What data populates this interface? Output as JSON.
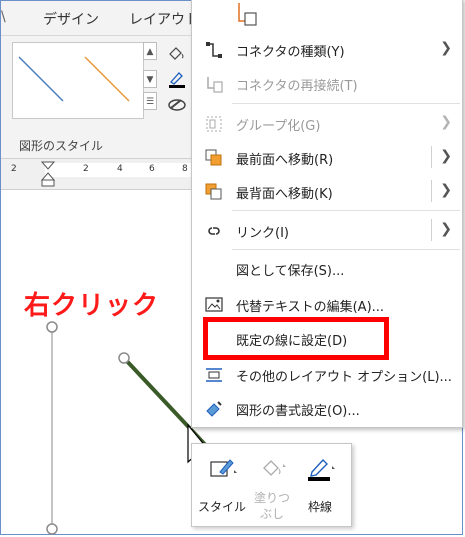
{
  "ribbon": {
    "tabs": [
      {
        "label": "デザイン"
      },
      {
        "label": "レイアウト"
      }
    ],
    "group_label": "図形のスタイル",
    "ruler_numbers": [
      "2",
      "2",
      "4",
      "6",
      "8"
    ]
  },
  "annotation": {
    "text": "右クリック",
    "color": "#ff1a1a"
  },
  "context_menu": {
    "items": [
      {
        "label": "コネクタの種類(Y)",
        "icon": "connector-type-icon",
        "submenu": true,
        "disabled": false
      },
      {
        "label": "コネクタの再接続(T)",
        "icon": "reroute-connector-icon",
        "submenu": false,
        "disabled": true
      },
      {
        "label": "グループ化(G)",
        "icon": "group-icon",
        "submenu": true,
        "disabled": true
      },
      {
        "label": "最前面へ移動(R)",
        "icon": "bring-to-front-icon",
        "submenu": true,
        "disabled": false
      },
      {
        "label": "最背面へ移動(K)",
        "icon": "send-to-back-icon",
        "submenu": true,
        "disabled": false
      },
      {
        "label": "リンク(I)",
        "icon": "link-icon",
        "submenu": true,
        "disabled": false
      },
      {
        "label": "図として保存(S)...",
        "icon": "",
        "submenu": false,
        "disabled": false
      },
      {
        "label": "代替テキストの編集(A)...",
        "icon": "alt-text-icon",
        "submenu": false,
        "disabled": false
      },
      {
        "label": "既定の線に設定(D)",
        "icon": "",
        "submenu": false,
        "disabled": false
      },
      {
        "label": "その他のレイアウト オプション(L)...",
        "icon": "layout-options-icon",
        "submenu": false,
        "disabled": false
      },
      {
        "label": "図形の書式設定(O)...",
        "icon": "format-shape-icon",
        "submenu": false,
        "disabled": false
      }
    ],
    "highlight_color": "#ff0000"
  },
  "mini_toolbar": {
    "style_label": "スタイル",
    "fill_label": "塗りつぶし",
    "outline_label": "枠線"
  },
  "colors": {
    "line_blue": "#4a7fc1",
    "line_orange": "#e8963b",
    "connector_green": "#3a5a28",
    "frame_border": "#6b8fc9"
  }
}
